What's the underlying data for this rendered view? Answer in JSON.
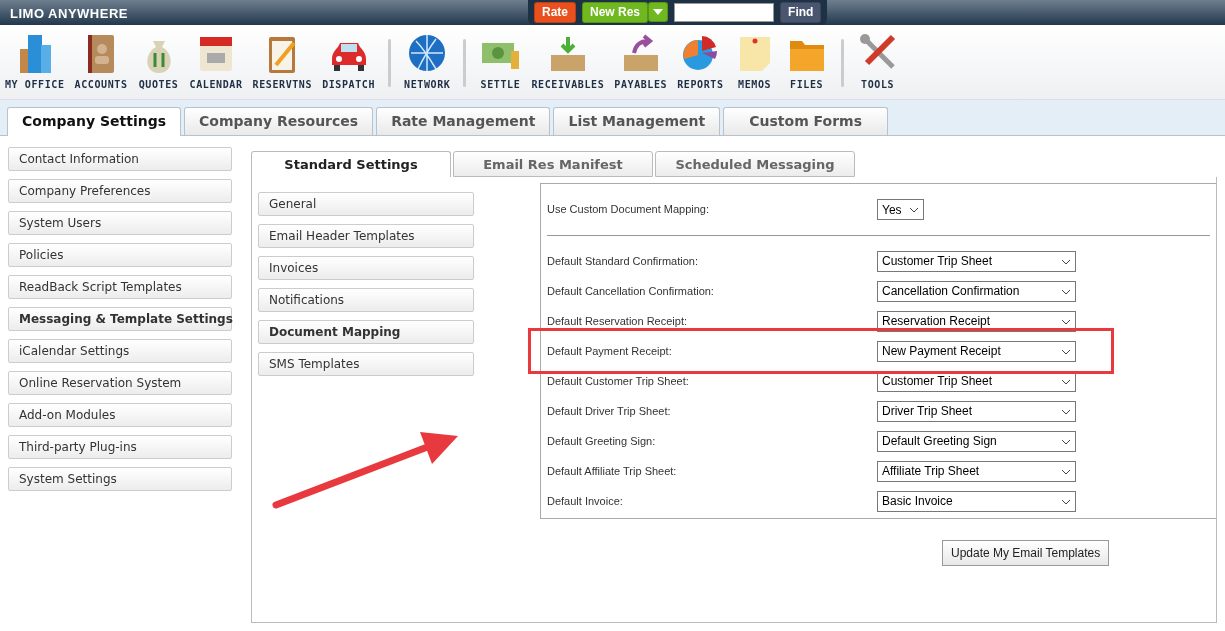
{
  "header": {
    "logo": "LIMO ANYWHERE",
    "rate_button": "Rate",
    "new_res_button": "New Res",
    "find_button": "Find"
  },
  "toolbar_groups": [
    [
      {
        "label": "MY OFFICE"
      },
      {
        "label": "ACCOUNTS"
      },
      {
        "label": "QUOTES"
      },
      {
        "label": "CALENDAR"
      },
      {
        "label": "RESERVTNS"
      },
      {
        "label": "DISPATCH"
      }
    ],
    [
      {
        "label": "NETWORK"
      }
    ],
    [
      {
        "label": "SETTLE"
      },
      {
        "label": "RECEIVABLES"
      },
      {
        "label": "PAYABLES"
      },
      {
        "label": "REPORTS"
      },
      {
        "label": "MEMOS"
      },
      {
        "label": "FILES"
      }
    ],
    [
      {
        "label": "TOOLS"
      }
    ]
  ],
  "tabs": [
    {
      "label": "Company Settings",
      "selected": true
    },
    {
      "label": "Company Resources",
      "selected": false
    },
    {
      "label": "Rate Management",
      "selected": false
    },
    {
      "label": "List Management",
      "selected": false
    },
    {
      "label": "Custom Forms",
      "selected": false
    }
  ],
  "sidebar": {
    "items": [
      {
        "label": "Contact Information",
        "selected": false
      },
      {
        "label": "Company Preferences",
        "selected": false
      },
      {
        "label": "System Users",
        "selected": false
      },
      {
        "label": "Policies",
        "selected": false
      },
      {
        "label": "ReadBack Script Templates",
        "selected": false
      },
      {
        "label": "Messaging & Template Settings",
        "selected": true
      },
      {
        "label": "iCalendar Settings",
        "selected": false
      },
      {
        "label": "Online Reservation System",
        "selected": false
      },
      {
        "label": "Add-on Modules",
        "selected": false
      },
      {
        "label": "Third-party Plug-ins",
        "selected": false
      },
      {
        "label": "System Settings",
        "selected": false
      }
    ]
  },
  "sub_tabs": [
    {
      "label": "Standard Settings",
      "selected": true
    },
    {
      "label": "Email Res Manifest",
      "selected": false
    },
    {
      "label": "Scheduled Messaging",
      "selected": false
    }
  ],
  "sub_menu": [
    {
      "label": "General",
      "selected": false
    },
    {
      "label": "Email Header Templates",
      "selected": false
    },
    {
      "label": "Invoices",
      "selected": false
    },
    {
      "label": "Notifications",
      "selected": false
    },
    {
      "label": "Document Mapping",
      "selected": true
    },
    {
      "label": "SMS Templates",
      "selected": false
    }
  ],
  "custom_mapping": {
    "label": "Use Custom Document Mapping:",
    "value": "Yes"
  },
  "mappings": [
    {
      "label": "Default Standard Confirmation:",
      "value": "Customer Trip Sheet",
      "highlighted": false
    },
    {
      "label": "Default Cancellation Confirmation:",
      "value": "Cancellation Confirmation",
      "highlighted": false
    },
    {
      "label": "Default Reservation Receipt:",
      "value": "Reservation Receipt",
      "highlighted": false
    },
    {
      "label": "Default Payment Receipt:",
      "value": "New Payment Receipt",
      "highlighted": true
    },
    {
      "label": "Default Customer Trip Sheet:",
      "value": "Customer Trip Sheet",
      "highlighted": false
    },
    {
      "label": "Default Driver Trip Sheet:",
      "value": "Driver Trip Sheet",
      "highlighted": false
    },
    {
      "label": "Default Greeting Sign:",
      "value": "Default Greeting Sign",
      "highlighted": false
    },
    {
      "label": "Default Affiliate Trip Sheet:",
      "value": "Affiliate Trip Sheet",
      "highlighted": false
    },
    {
      "label": "Default Invoice:",
      "value": "Basic Invoice",
      "highlighted": false
    }
  ],
  "update_button": "Update My Email Templates"
}
